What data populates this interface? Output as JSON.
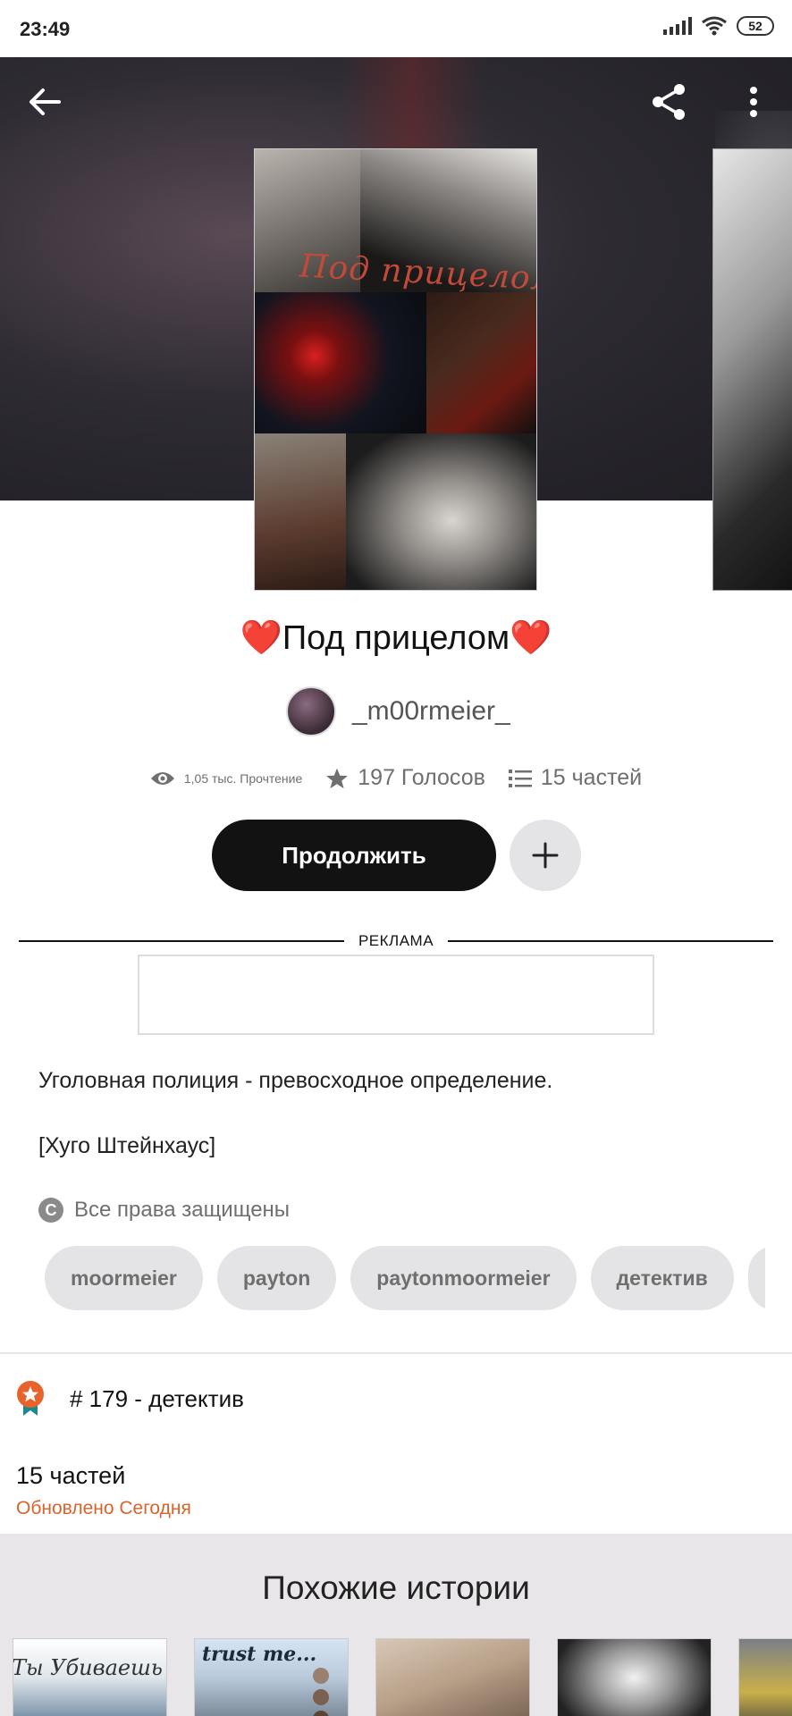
{
  "status_bar": {
    "time": "23:49",
    "battery": "52"
  },
  "story": {
    "cover_title_art": "Под прицелом",
    "title": "❤️Под прицелом❤️",
    "author": "_m00rmeier_"
  },
  "stats": {
    "reads": "1,05 тыс. Прочтение",
    "votes": "197 Голосов",
    "parts": "15 частей"
  },
  "actions": {
    "continue_label": "Продолжить"
  },
  "ad": {
    "label": "РЕКЛАМА"
  },
  "description": {
    "line1": "Уголовная полиция - превосходное определение.",
    "line2": "[Хуго Штейнхаус]",
    "rights": "Все права защищены"
  },
  "tags": [
    "moormeier",
    "payton",
    "paytonmoormeier",
    "детектив"
  ],
  "ranking": {
    "label": "# 179 - детектив"
  },
  "parts_section": {
    "count": "15 частей",
    "updated": "Обновлено Сегодня"
  },
  "similar": {
    "heading": "Похожие истории",
    "cover1_text": "Ты Убиваешь меня.",
    "cover2_text": "trust me..."
  },
  "colors": {
    "accent_orange": "#d9632b",
    "dark": "#121212",
    "pill_grey": "#e4e4e6"
  }
}
